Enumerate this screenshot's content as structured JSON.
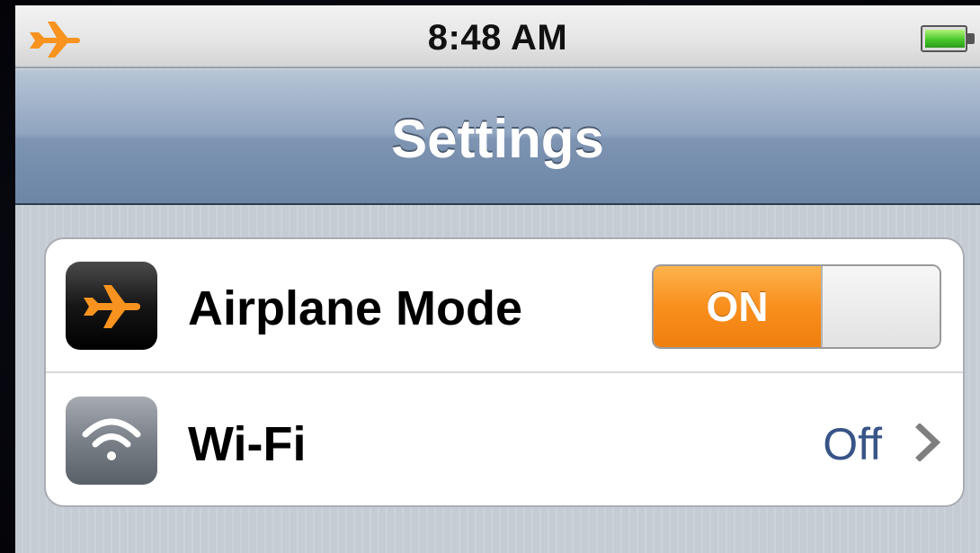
{
  "status_bar": {
    "time": "8:48 AM",
    "airplane_icon": "airplane-icon",
    "battery_icon": "battery-icon"
  },
  "nav_bar": {
    "title": "Settings"
  },
  "settings": {
    "rows": [
      {
        "label": "Airplane Mode",
        "icon": "airplane-icon",
        "toggle_state": "ON"
      },
      {
        "label": "Wi-Fi",
        "icon": "wifi-icon",
        "value": "Off",
        "accessory": "chevron-right-icon"
      }
    ]
  },
  "colors": {
    "accent_orange": "#f98f1d",
    "nav_blue": "#7d94b2",
    "value_blue": "#385487",
    "battery_green": "#47c82a"
  }
}
